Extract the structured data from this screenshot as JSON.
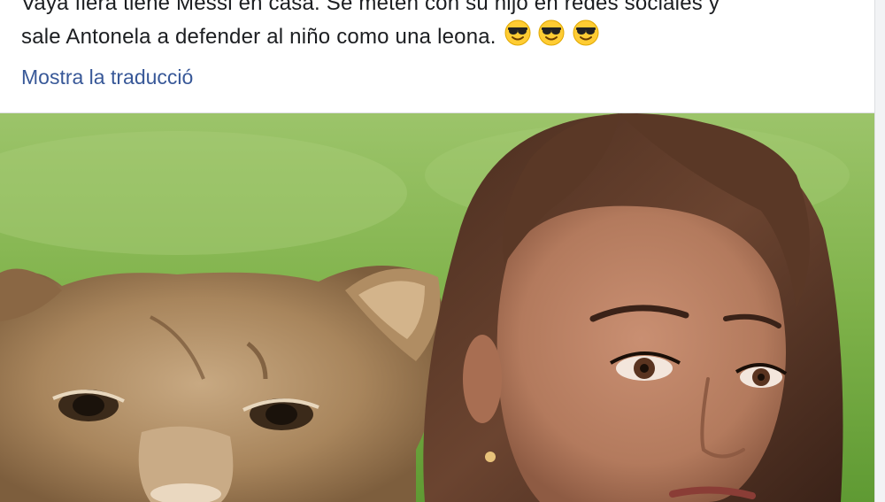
{
  "post": {
    "text_line_1": "Vaya fiera tiene Messi en casa. Se meten con su hijo en redes sociales y",
    "text_line_2": "sale Antonela a defender al niño como una leona.",
    "emojis": [
      "sunglasses-emoji",
      "sunglasses-emoji",
      "sunglasses-emoji"
    ],
    "translate_link": "Mostra la traducció"
  },
  "image": {
    "subjects": [
      "lioness",
      "woman"
    ]
  },
  "colors": {
    "text": "#1c1e21",
    "link": "#385898",
    "divider": "#dddfe2",
    "grass": "#7fb24a"
  }
}
